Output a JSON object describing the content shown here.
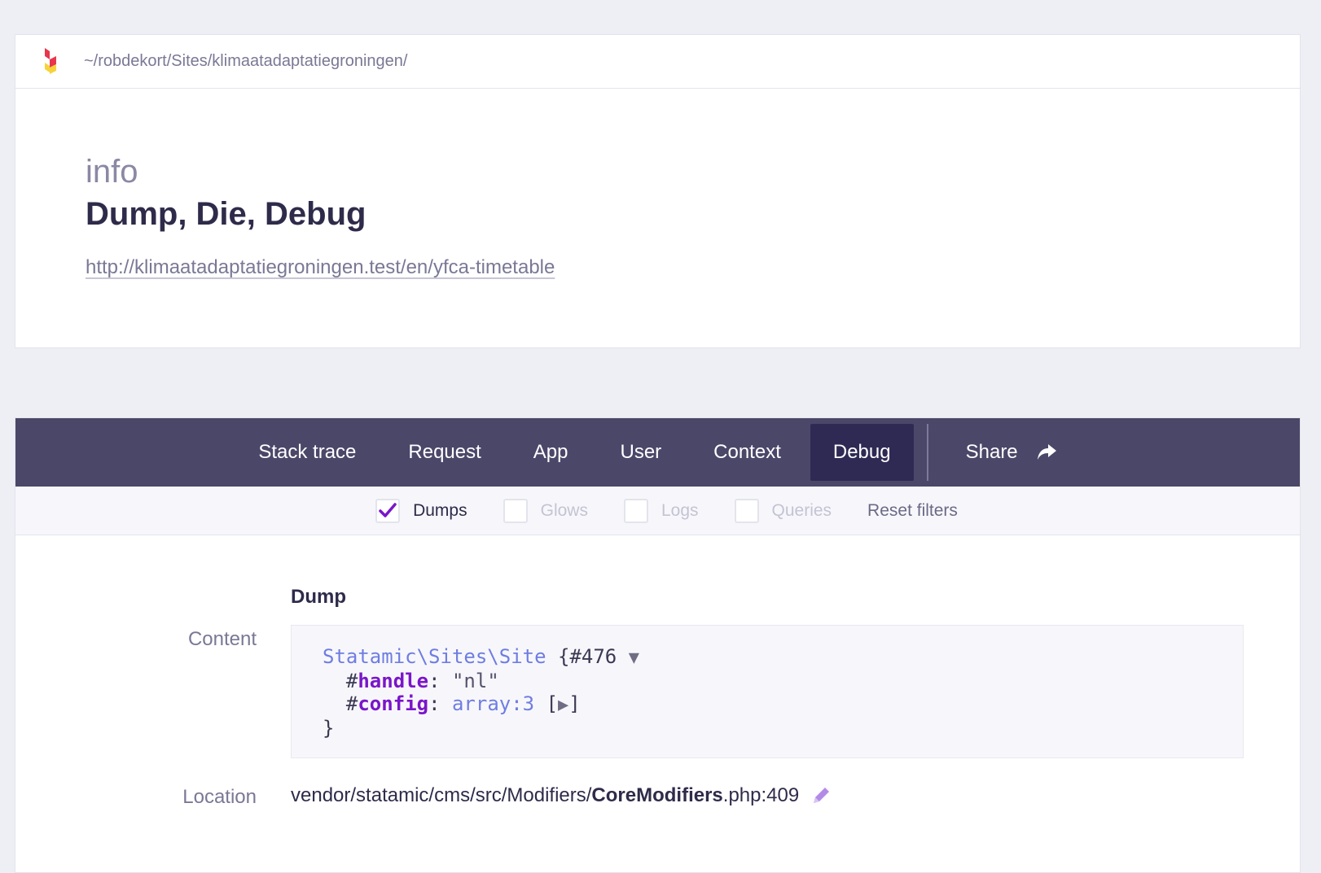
{
  "header": {
    "path": "~/robdekort/Sites/klimaatadaptatiegroningen/"
  },
  "info": {
    "level": "info",
    "title": "Dump, Die, Debug",
    "url": "http://klimaatadaptatiegroningen.test/en/yfca-timetable"
  },
  "nav": {
    "items": [
      {
        "label": "Stack trace"
      },
      {
        "label": "Request"
      },
      {
        "label": "App"
      },
      {
        "label": "User"
      },
      {
        "label": "Context"
      },
      {
        "label": "Debug",
        "active": true
      }
    ],
    "share_label": "Share"
  },
  "filters": {
    "items": [
      {
        "label": "Dumps",
        "checked": true
      },
      {
        "label": "Glows",
        "checked": false
      },
      {
        "label": "Logs",
        "checked": false
      },
      {
        "label": "Queries",
        "checked": false
      }
    ],
    "reset_label": "Reset filters"
  },
  "dump": {
    "heading": "Dump",
    "content_label": "Content",
    "location_label": "Location",
    "code": {
      "class_name": "Statamic\\Sites\\Site",
      "object_ref": "{#476",
      "toggle_open": "▼",
      "prop1_key": "handle",
      "prop1_val": "\"nl\"",
      "prop2_key": "config",
      "prop2_val": "array:3",
      "toggle_closed": "▶",
      "close_brace": "}"
    },
    "location": {
      "prefix": "vendor/statamic/cms/src/Modifiers/",
      "file": "CoreModifiers",
      "suffix": ".php:409"
    }
  },
  "colors": {
    "nav_bg": "#4b4769",
    "nav_active": "#2f2a54",
    "accent_purple": "#7a16c9",
    "class_blue": "#6f7de2"
  }
}
